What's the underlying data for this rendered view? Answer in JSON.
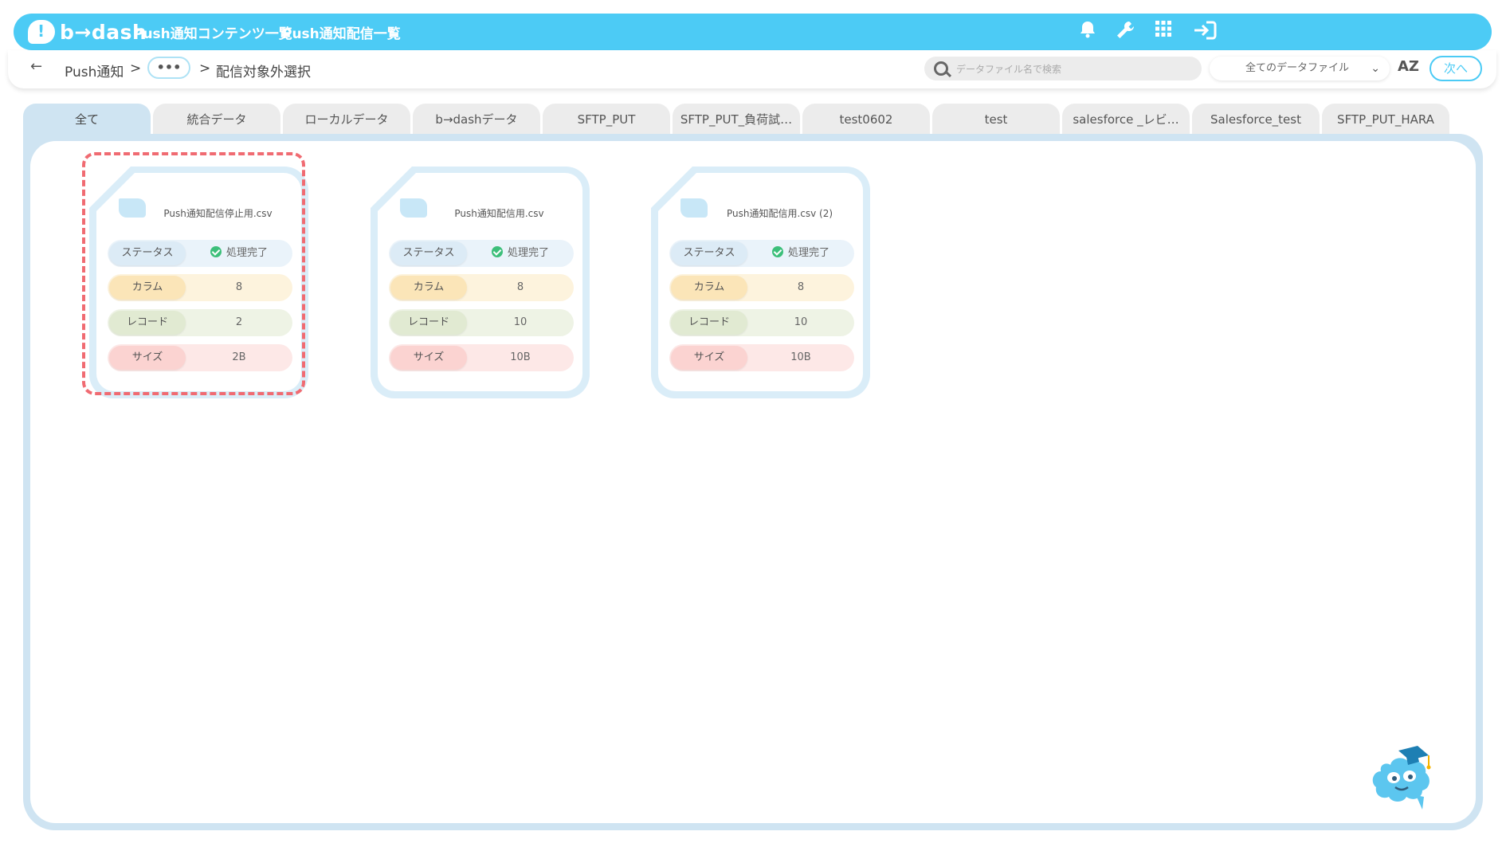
{
  "app": {
    "logo_text": "b→dash"
  },
  "nav": {
    "link1": "Push通知コンテンツ一覧",
    "link2": "Push通知配信一覧"
  },
  "breadcrumb": {
    "root": "Push通知",
    "sep1": ">",
    "ellipsis": "•••",
    "sep2": ">",
    "current": "配信対象外選択"
  },
  "search": {
    "placeholder": "データファイル名で検索"
  },
  "filter": {
    "selected": "全てのデータファイル"
  },
  "sort": {
    "label": "AZ"
  },
  "next_button": "次へ",
  "tabs": [
    "全て",
    "統合データ",
    "ローカルデータ",
    "b→dashデータ",
    "SFTP_PUT",
    "SFTP_PUT_負荷試…",
    "test0602",
    "test",
    "salesforce _レビ…",
    "Salesforce_test",
    "SFTP_PUT_HARA"
  ],
  "active_tab": "全て",
  "stat_labels": {
    "status": "ステータス",
    "columns": "カラム",
    "records": "レコード",
    "size": "サイズ"
  },
  "cards": [
    {
      "name": "Push通知配信停止用.csv",
      "status": "処理完了",
      "columns": "8",
      "records": "2",
      "size": "2B",
      "selected": true
    },
    {
      "name": "Push通知配信用.csv",
      "status": "処理完了",
      "columns": "8",
      "records": "10",
      "size": "10B",
      "selected": false
    },
    {
      "name": "Push通知配信用.csv (2)",
      "status": "処理完了",
      "columns": "8",
      "records": "10",
      "size": "10B",
      "selected": false
    }
  ],
  "colors": {
    "brand": "#4ccbf5",
    "highlight": "#f06b72",
    "success": "#3cbf7a"
  },
  "icons": [
    "bell-icon",
    "wrench-icon",
    "grid-icon",
    "logout-icon",
    "search-icon",
    "chevron-down-icon",
    "back-arrow-icon",
    "check-icon",
    "mascot-icon"
  ]
}
